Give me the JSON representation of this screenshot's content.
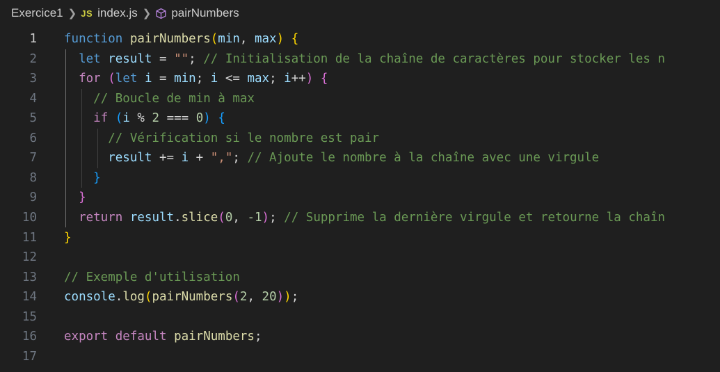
{
  "breadcrumb": {
    "folder": "Exercice1",
    "file_icon": "JS",
    "file": "index.js",
    "symbol_icon": "cube-icon",
    "symbol": "pairNumbers"
  },
  "editor": {
    "active_line": 1,
    "line_numbers": [
      "1",
      "2",
      "3",
      "4",
      "5",
      "6",
      "7",
      "8",
      "9",
      "10",
      "11",
      "12",
      "13",
      "14",
      "15",
      "16",
      "17"
    ],
    "lines": [
      [
        [
          "kw",
          "function"
        ],
        [
          "op",
          " "
        ],
        [
          "fn",
          "pairNumbers"
        ],
        [
          "b1",
          "("
        ],
        [
          "var",
          "min"
        ],
        [
          "op",
          ", "
        ],
        [
          "var",
          "max"
        ],
        [
          "b1",
          ")"
        ],
        [
          "op",
          " "
        ],
        [
          "b1",
          "{"
        ]
      ],
      [
        [
          "op",
          "  "
        ],
        [
          "kw",
          "let"
        ],
        [
          "op",
          " "
        ],
        [
          "var",
          "result"
        ],
        [
          "op",
          " = "
        ],
        [
          "str",
          "\"\""
        ],
        [
          "op",
          "; "
        ],
        [
          "cmt",
          "// Initialisation de la chaîne de caractères pour stocker les n"
        ]
      ],
      [
        [
          "op",
          "  "
        ],
        [
          "ctl",
          "for"
        ],
        [
          "op",
          " "
        ],
        [
          "b2",
          "("
        ],
        [
          "kw",
          "let"
        ],
        [
          "op",
          " "
        ],
        [
          "var",
          "i"
        ],
        [
          "op",
          " = "
        ],
        [
          "var",
          "min"
        ],
        [
          "op",
          "; "
        ],
        [
          "var",
          "i"
        ],
        [
          "op",
          " <= "
        ],
        [
          "var",
          "max"
        ],
        [
          "op",
          "; "
        ],
        [
          "var",
          "i"
        ],
        [
          "op",
          "++"
        ],
        [
          "b2",
          ")"
        ],
        [
          "op",
          " "
        ],
        [
          "b2",
          "{"
        ]
      ],
      [
        [
          "op",
          "    "
        ],
        [
          "cmt",
          "// Boucle de min à max"
        ]
      ],
      [
        [
          "op",
          "    "
        ],
        [
          "ctl",
          "if"
        ],
        [
          "op",
          " "
        ],
        [
          "b3",
          "("
        ],
        [
          "var",
          "i"
        ],
        [
          "op",
          " % "
        ],
        [
          "num",
          "2"
        ],
        [
          "op",
          " === "
        ],
        [
          "num",
          "0"
        ],
        [
          "b3",
          ")"
        ],
        [
          "op",
          " "
        ],
        [
          "b3",
          "{"
        ]
      ],
      [
        [
          "op",
          "      "
        ],
        [
          "cmt",
          "// Vérification si le nombre est pair"
        ]
      ],
      [
        [
          "op",
          "      "
        ],
        [
          "var",
          "result"
        ],
        [
          "op",
          " += "
        ],
        [
          "var",
          "i"
        ],
        [
          "op",
          " + "
        ],
        [
          "str",
          "\",\""
        ],
        [
          "op",
          "; "
        ],
        [
          "cmt",
          "// Ajoute le nombre à la chaîne avec une virgule"
        ]
      ],
      [
        [
          "op",
          "    "
        ],
        [
          "b3",
          "}"
        ]
      ],
      [
        [
          "op",
          "  "
        ],
        [
          "b2",
          "}"
        ]
      ],
      [
        [
          "op",
          "  "
        ],
        [
          "ctl",
          "return"
        ],
        [
          "op",
          " "
        ],
        [
          "var",
          "result"
        ],
        [
          "op",
          "."
        ],
        [
          "fn",
          "slice"
        ],
        [
          "b2",
          "("
        ],
        [
          "num",
          "0"
        ],
        [
          "op",
          ", "
        ],
        [
          "num",
          "-1"
        ],
        [
          "b2",
          ")"
        ],
        [
          "op",
          "; "
        ],
        [
          "cmt",
          "// Supprime la dernière virgule et retourne la chaîn"
        ]
      ],
      [
        [
          "b1",
          "}"
        ]
      ],
      [],
      [
        [
          "cmt",
          "// Exemple d'utilisation"
        ]
      ],
      [
        [
          "var",
          "console"
        ],
        [
          "op",
          "."
        ],
        [
          "fn",
          "log"
        ],
        [
          "b1",
          "("
        ],
        [
          "fn",
          "pairNumbers"
        ],
        [
          "b2",
          "("
        ],
        [
          "num",
          "2"
        ],
        [
          "op",
          ", "
        ],
        [
          "num",
          "20"
        ],
        [
          "b2",
          ")"
        ],
        [
          "b1",
          ")"
        ],
        [
          "op",
          ";"
        ]
      ],
      [],
      [
        [
          "ctl",
          "export"
        ],
        [
          "op",
          " "
        ],
        [
          "ctl",
          "default"
        ],
        [
          "op",
          " "
        ],
        [
          "fn",
          "pairNumbers"
        ],
        [
          "op",
          ";"
        ]
      ],
      []
    ]
  },
  "colors": {
    "background": "#1f1f1f",
    "keyword": "#569cd6",
    "control": "#c586c0",
    "function": "#dcdcaa",
    "variable": "#9cdcfe",
    "string": "#ce9178",
    "number": "#b5cea8",
    "comment": "#6a9955",
    "bracket1": "#ffd700",
    "bracket2": "#da70d6",
    "bracket3": "#179fff"
  }
}
